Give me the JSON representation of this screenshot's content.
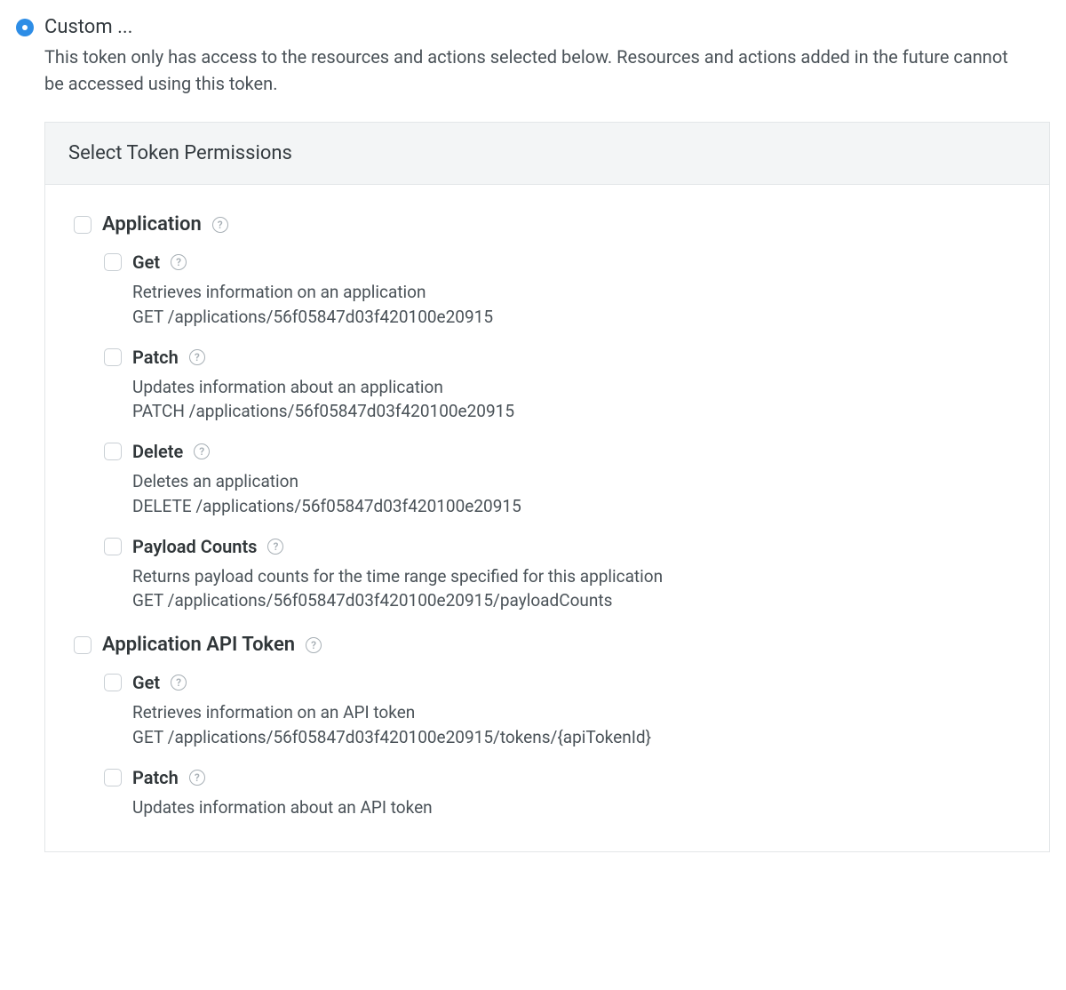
{
  "radio": {
    "label": "Custom ...",
    "description": "This token only has access to the resources and actions selected below. Resources and actions added in the future cannot be accessed using this token."
  },
  "panel": {
    "title": "Select Token Permissions"
  },
  "groups": [
    {
      "title": "Application",
      "permissions": [
        {
          "title": "Get",
          "desc": "Retrieves information on an application",
          "endpoint": "GET /applications/56f05847d03f420100e20915"
        },
        {
          "title": "Patch",
          "desc": "Updates information about an application",
          "endpoint": "PATCH /applications/56f05847d03f420100e20915"
        },
        {
          "title": "Delete",
          "desc": "Deletes an application",
          "endpoint": "DELETE /applications/56f05847d03f420100e20915"
        },
        {
          "title": "Payload Counts",
          "desc": "Returns payload counts for the time range specified for this application",
          "endpoint": "GET /applications/56f05847d03f420100e20915/payloadCounts"
        }
      ]
    },
    {
      "title": "Application API Token",
      "permissions": [
        {
          "title": "Get",
          "desc": "Retrieves information on an API token",
          "endpoint": "GET /applications/56f05847d03f420100e20915/tokens/{apiTokenId}"
        },
        {
          "title": "Patch",
          "desc": "Updates information about an API token",
          "endpoint": ""
        }
      ]
    }
  ]
}
